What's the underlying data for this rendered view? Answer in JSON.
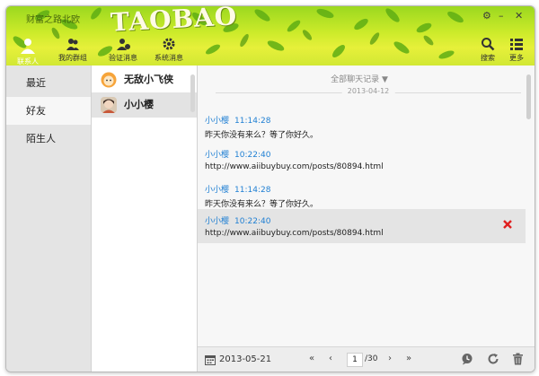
{
  "window": {
    "title": "财富之路北欧"
  },
  "header": {
    "logo_text": "TAOBAO",
    "controls": {
      "settings": "⚙",
      "minimize": "–",
      "close": "✕"
    },
    "toolbar": [
      {
        "label": "联系人",
        "icon": "person-icon"
      },
      {
        "label": "我的群组",
        "icon": "group-icon"
      },
      {
        "label": "验证消息",
        "icon": "verify-icon"
      },
      {
        "label": "系统消息",
        "icon": "system-icon"
      },
      {
        "label": "搜索",
        "icon": "search-icon"
      },
      {
        "label": "更多",
        "icon": "list-icon"
      }
    ]
  },
  "categories": [
    {
      "label": "最近"
    },
    {
      "label": "好友"
    },
    {
      "label": "陌生人"
    }
  ],
  "friends": [
    {
      "name": "无敌小飞侠",
      "avatar": "orange-face"
    },
    {
      "name": "小小樱",
      "avatar": "girl-photo"
    }
  ],
  "chat": {
    "history_label": "全部聊天记录 ▼",
    "date_separator": "2013-04-12",
    "messages": [
      {
        "sender": "小小樱",
        "time": "11:14:28",
        "text": "昨天你没有来么？等了你好久。"
      },
      {
        "sender": "小小樱",
        "time": "10:22:40",
        "text": "http://www.aiibuybuy.com/posts/80894.html"
      },
      {
        "sender": "小小樱",
        "time": "11:14:28",
        "text": "昨天你没有来么？等了你好久。"
      },
      {
        "sender": "小小樱",
        "time": "10:22:40",
        "text": "http://www.aiibuybuy.com/posts/80894.html"
      }
    ],
    "delete_color": "#e02020"
  },
  "footer": {
    "date": "2013-05-21",
    "first": "«",
    "prev": "‹",
    "page": "1",
    "total": "/30",
    "next": "›",
    "last": "»"
  },
  "colors": {
    "accent": "#1f7fd3",
    "header_green": "#9bd81f",
    "header_yellow": "#e6f03a"
  }
}
